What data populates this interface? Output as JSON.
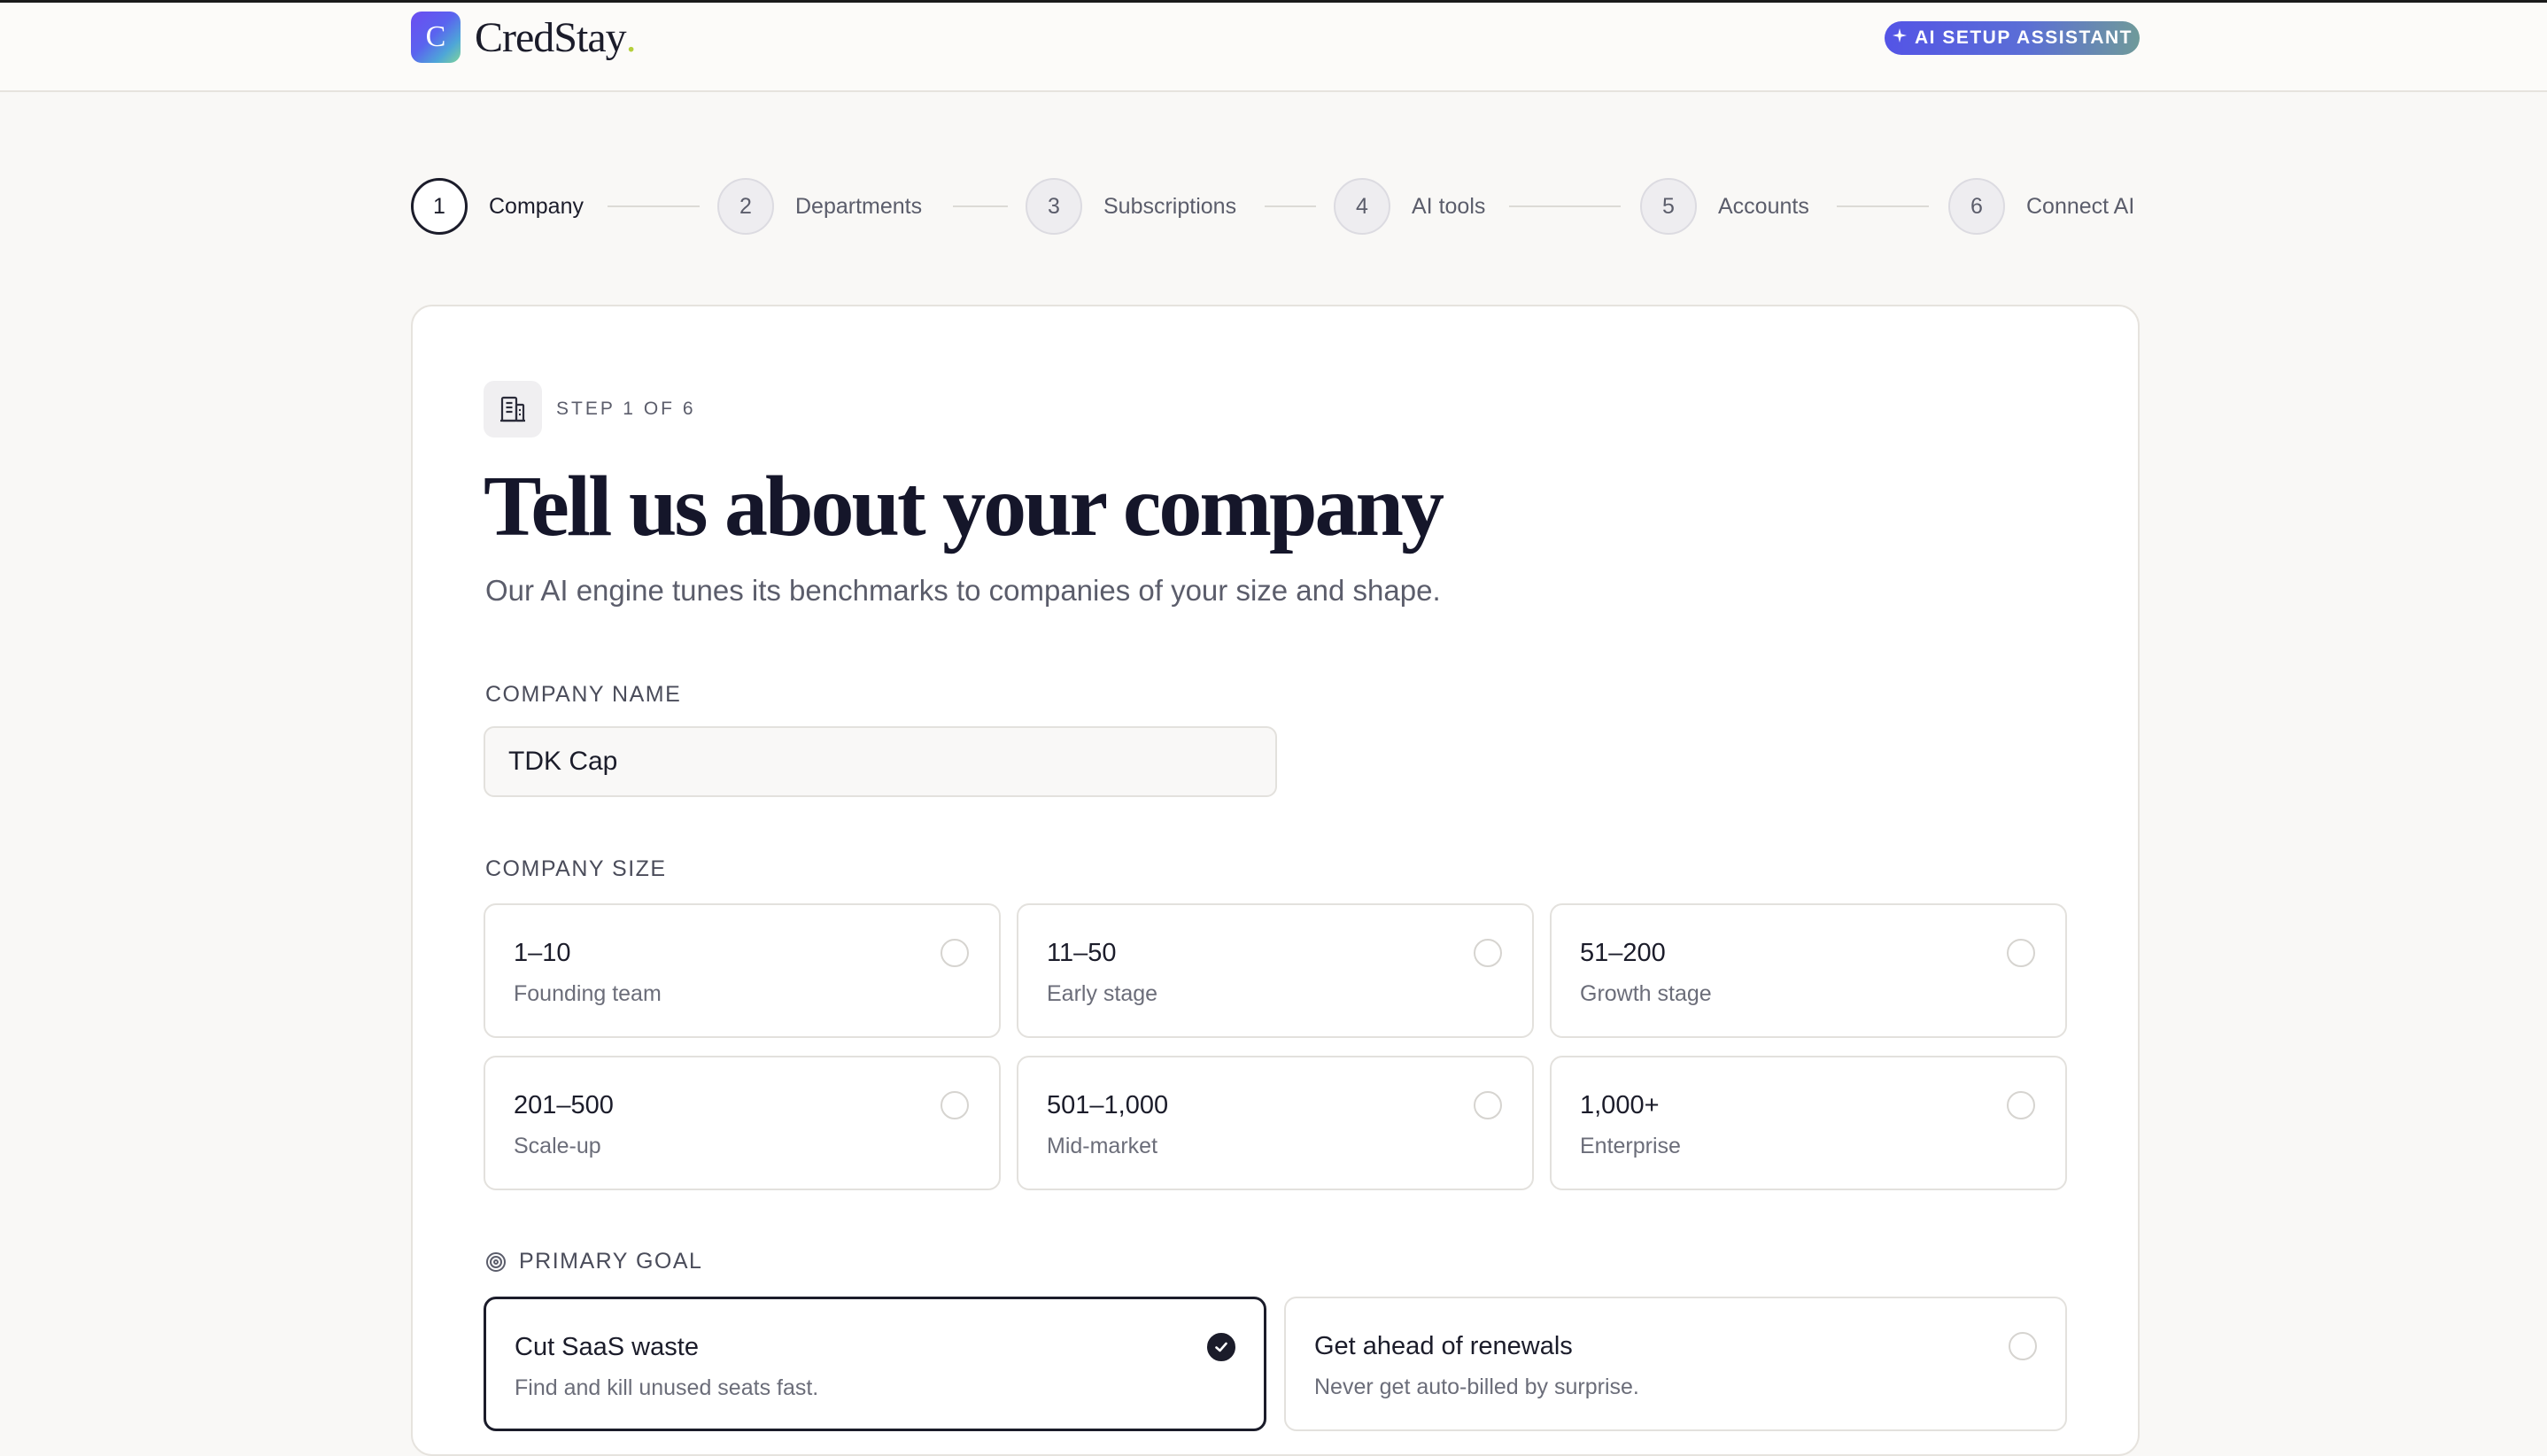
{
  "header": {
    "logo_letter": "C",
    "brand": "CredStay",
    "brand_dot": ".",
    "ai_badge": "AI SETUP ASSISTANT"
  },
  "stepper": {
    "steps": [
      {
        "num": "1",
        "label": "Company",
        "active": true
      },
      {
        "num": "2",
        "label": "Departments",
        "active": false
      },
      {
        "num": "3",
        "label": "Subscriptions",
        "active": false
      },
      {
        "num": "4",
        "label": "AI tools",
        "active": false
      },
      {
        "num": "5",
        "label": "Accounts",
        "active": false
      },
      {
        "num": "6",
        "label": "Connect AI",
        "active": false
      }
    ]
  },
  "card": {
    "step_meta": "STEP 1 OF 6",
    "title": "Tell us about your company",
    "subtitle": "Our AI engine tunes its benchmarks to companies of your size and shape.",
    "company_name": {
      "label": "COMPANY NAME",
      "value": "TDK Cap"
    },
    "company_size": {
      "label": "COMPANY SIZE",
      "options": [
        {
          "title": "1–10",
          "subtitle": "Founding team",
          "selected": false
        },
        {
          "title": "11–50",
          "subtitle": "Early stage",
          "selected": false
        },
        {
          "title": "51–200",
          "subtitle": "Growth stage",
          "selected": false
        },
        {
          "title": "201–500",
          "subtitle": "Scale-up",
          "selected": false
        },
        {
          "title": "501–1,000",
          "subtitle": "Mid-market",
          "selected": false
        },
        {
          "title": "1,000+",
          "subtitle": "Enterprise",
          "selected": false
        }
      ]
    },
    "primary_goal": {
      "label": "PRIMARY GOAL",
      "options": [
        {
          "title": "Cut SaaS waste",
          "subtitle": "Find and kill unused seats fast.",
          "selected": true
        },
        {
          "title": "Get ahead of renewals",
          "subtitle": "Never get auto-billed by surprise.",
          "selected": false
        }
      ]
    }
  },
  "colors": {
    "accent": "#5454e6",
    "ink": "#1b1c2a",
    "muted": "#5b5d6b",
    "background": "#f9f8f6"
  },
  "icons": {
    "step_icon": "building-icon",
    "goal_icon": "target-icon",
    "badge_icon": "sparkle-icon",
    "selected_icon": "check-icon"
  }
}
